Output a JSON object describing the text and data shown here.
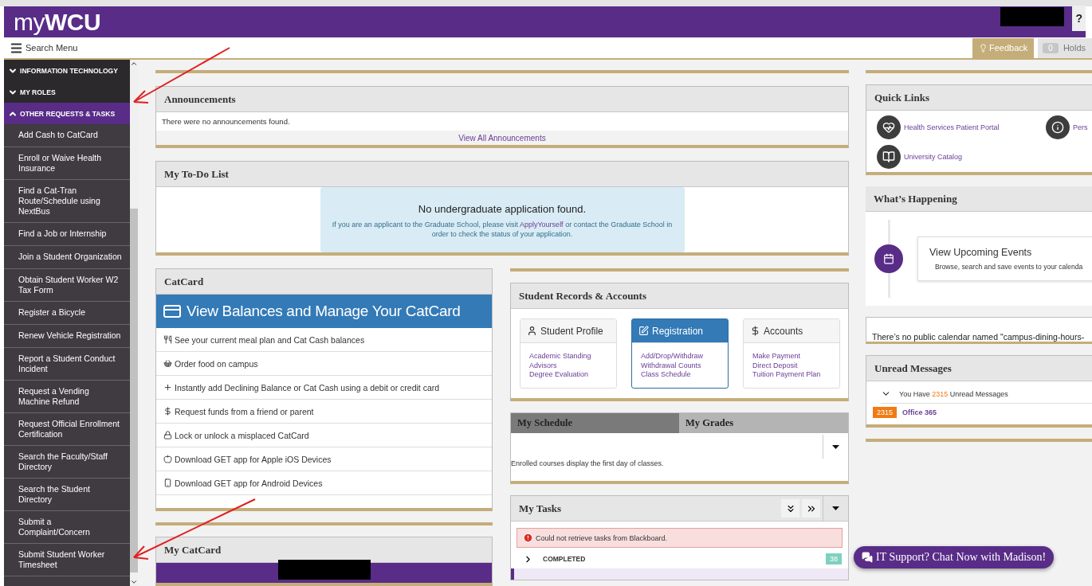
{
  "header": {
    "logo_prefix": "my",
    "logo_main": "WCU",
    "help": "?"
  },
  "toolbar": {
    "search_menu": "Search Menu",
    "feedback": "Feedback",
    "holds_count": "0",
    "holds": "Holds"
  },
  "sidebar": {
    "sections": [
      {
        "label": "INFORMATION TECHNOLOGY",
        "expanded": false
      },
      {
        "label": "MY ROLES",
        "expanded": false
      },
      {
        "label": "OTHER REQUESTS & TASKS",
        "expanded": true,
        "items": [
          "Add Cash to CatCard",
          "Enroll or Waive Health Insurance",
          "Find a Cat-Tran Route/Schedule using NextBus",
          "Find a Job or Internship",
          "Join a Student Organization",
          "Obtain Student Worker W2 Tax Form",
          "Register a Bicycle",
          "Renew Vehicle Registration",
          "Report a Student Conduct Incident",
          "Request a Vending Machine Refund",
          "Request Official Enrollment Certification",
          "Search the Faculty/Staff Directory",
          "Search the Student Directory",
          "Submit a Complaint/Concern",
          "Submit Student Worker Timesheet"
        ]
      }
    ]
  },
  "announcements": {
    "title": "Announcements",
    "message": "There were no announcements found.",
    "link": "View All Announcements"
  },
  "todo": {
    "title": "My To-Do List",
    "heading": "No undergraduate application found.",
    "text": "If you are an applicant to the Graduate School, please visit **ApplyYourself** or contact the Graduate School in order to check the status of your application."
  },
  "catcard": {
    "title": "CatCard",
    "banner": "View Balances and Manage Your CatCard",
    "links": [
      "See your current meal plan and Cat Cash balances",
      "Order food on campus",
      "Instantly add Declining Balance or Cat Cash using a debit or credit card",
      "Request funds from a friend or parent",
      "Lock or unlock a misplaced CatCard",
      "Download GET app for Apple iOS Devices",
      "Download GET app for Android Devices"
    ]
  },
  "my_catcard": {
    "title": "My CatCard"
  },
  "student_records": {
    "title": "Student Records & Accounts",
    "tiles": [
      {
        "title": "Student Profile",
        "selected": false,
        "links": [
          "Academic Standing",
          "Advisors",
          "Degree Evaluation"
        ]
      },
      {
        "title": "Registration",
        "selected": true,
        "links": [
          "Add/Drop/Withdraw",
          "Withdrawal Counts",
          "Class Schedule"
        ]
      },
      {
        "title": "Accounts",
        "selected": false,
        "links": [
          "Make Payment",
          "Direct Deposit",
          "Tuition Payment Plan"
        ]
      }
    ]
  },
  "schedule": {
    "tabs": [
      {
        "label": "My Schedule",
        "selected": true
      },
      {
        "label": "My Grades",
        "selected": false
      }
    ],
    "message": "Enrolled courses display the first day of classes."
  },
  "tasks": {
    "title": "My Tasks",
    "error": "Could not retrieve tasks from Blackboard.",
    "groups": [
      {
        "label": "COMPLETED",
        "count": "38",
        "expanded": false
      }
    ]
  },
  "quick_links": {
    "title": "Quick Links",
    "links": [
      "Health Services Patient Portal",
      "Pers",
      "University Catalog"
    ]
  },
  "whats_happening": {
    "title": "What’s Happening",
    "event_title": "View Upcoming Events",
    "event_text": "Browse, search and save events to your calenda"
  },
  "calendar_notice": "There’s no public calendar named \"campus-dining-hours-",
  "unread": {
    "title": "Unread Messages",
    "summary_before": "You Have",
    "count": "2315",
    "summary_after": "Unread Messages",
    "sources": [
      {
        "count": "2315",
        "name": "Office 365"
      }
    ]
  },
  "chat": "IT Support? Chat Now with Madison!"
}
